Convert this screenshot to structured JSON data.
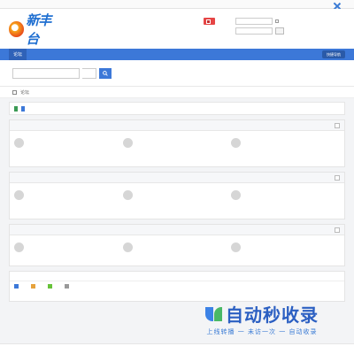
{
  "topbar": {
    "links": [
      "",
      ""
    ],
    "right_text": ""
  },
  "header": {
    "logo_text": "新丰台",
    "logo_url": "",
    "qr_label": "",
    "qr_sub": "",
    "username_label": "",
    "password_label": "",
    "auto_login": "",
    "find_password": "",
    "login_btn": "",
    "register": ""
  },
  "nav": {
    "items": [
      "论坛"
    ],
    "quick_nav": "快捷导航"
  },
  "search": {
    "placeholder": "",
    "scope": "",
    "hot_label": "",
    "hot_words": [
      "",
      "",
      ""
    ]
  },
  "breadcrumb": {
    "home": "",
    "current": "论坛"
  },
  "stats": {
    "text": "",
    "rss": ""
  },
  "sections": [
    {
      "title": "",
      "forums": [
        {
          "name": "",
          "stats": "",
          "last": ""
        },
        {
          "name": "",
          "stats": "",
          "last": ""
        },
        {
          "name": "",
          "stats": "",
          "last": ""
        }
      ]
    },
    {
      "title": "",
      "forums": [
        {
          "name": "",
          "stats": "",
          "last": ""
        },
        {
          "name": "",
          "stats": "",
          "last": ""
        },
        {
          "name": "",
          "stats": "",
          "last": ""
        }
      ]
    },
    {
      "title": "",
      "forums": [
        {
          "name": "",
          "stats": "",
          "last": ""
        },
        {
          "name": "",
          "stats": "",
          "last": ""
        },
        {
          "name": "",
          "stats": "",
          "last": ""
        }
      ]
    }
  ],
  "online": {
    "head": "",
    "legend": [
      "",
      "",
      "",
      ""
    ],
    "note": ""
  },
  "footer": {
    "powered": "",
    "version": "",
    "links": [
      "",
      "",
      "",
      ""
    ]
  },
  "watermark": {
    "line1": "自动秒收录",
    "line2": "上线转播 一 未访一次 一 自动收录"
  },
  "colors": {
    "brand_blue": "#3c78d8",
    "accent_red": "#e64545"
  }
}
